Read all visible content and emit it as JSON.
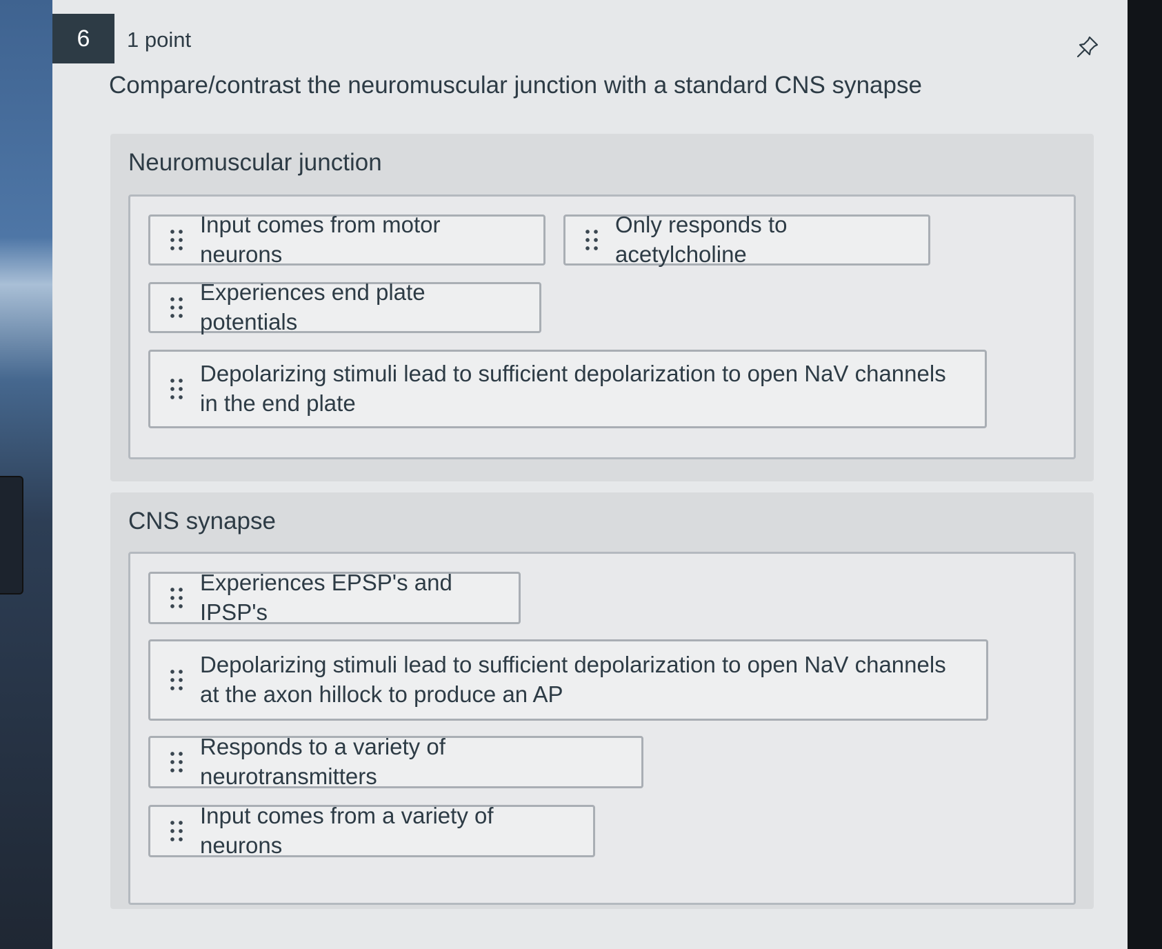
{
  "question": {
    "number": "6",
    "points": "1 point",
    "text": "Compare/contrast the neuromuscular junction with a standard CNS synapse",
    "pin_icon": "pin-icon"
  },
  "categories": [
    {
      "title": "Neuromuscular junction",
      "items": [
        "Input comes from motor neurons",
        "Only responds to acetylcholine",
        "Experiences end plate potentials",
        "Depolarizing stimuli lead to sufficient depolarization to open NaV channels in the end plate"
      ]
    },
    {
      "title": "CNS synapse",
      "items": [
        "Experiences EPSP's and IPSP's",
        "Depolarizing stimuli lead to sufficient depolarization to open NaV channels at the axon hillock to produce an AP",
        "Responds to a variety of neurotransmitters",
        "Input comes from a variety of neurons"
      ]
    }
  ],
  "colors": {
    "question_number_bg": "#2d3b45",
    "text": "#2d3b45",
    "category_bg": "#d9dbdd",
    "chip_border": "#a9aeb4"
  }
}
